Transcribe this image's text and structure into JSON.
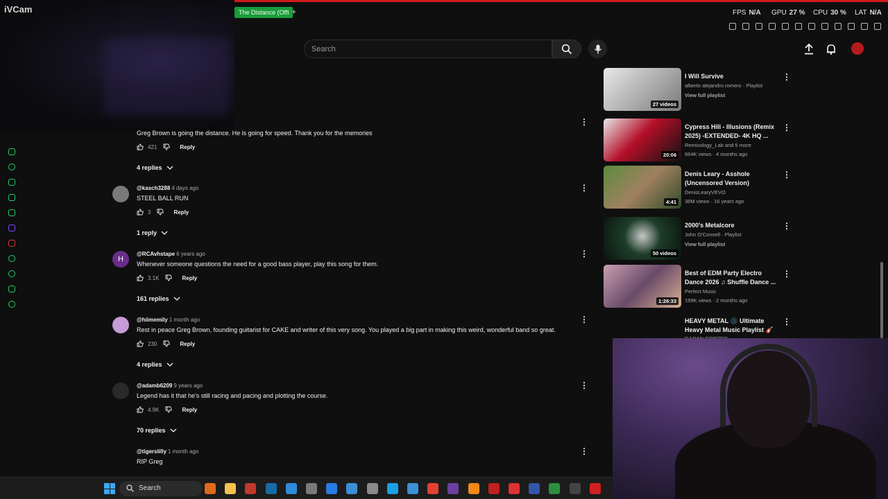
{
  "overlay": {
    "app_name": "iVCam",
    "tab_label": "The Distance (Offi",
    "new_tab": "+",
    "perf": {
      "fps_label": "FPS",
      "fps_value": "N/A",
      "gpu_label": "GPU",
      "gpu_value": "27 %",
      "cpu_label": "CPU",
      "cpu_value": "30 %",
      "lat_label": "LAT",
      "lat_value": "N/A"
    }
  },
  "header": {
    "search_placeholder": "Search",
    "icons": [
      "search-icon",
      "mic-icon",
      "upload-icon",
      "bell-icon",
      "avatar"
    ]
  },
  "comments": [
    {
      "author": "",
      "time": "",
      "text": "Greg Brown is going the distance. He is going for speed. Thank you for the memories",
      "likes": "421",
      "reply_label": "Reply",
      "replies": "4 replies"
    },
    {
      "author": "@kasch3288",
      "time": "4 days ago",
      "text": "STEEL BALL RUN",
      "likes": "3",
      "reply_label": "Reply",
      "replies": "1 reply"
    },
    {
      "author": "@RCAvhstape",
      "time": "6 years ago",
      "avatar_letter": "H",
      "text": "Whenever someone questions the need for a good bass player, play this song for them.",
      "likes": "3.1K",
      "reply_label": "Reply",
      "replies": "161 replies"
    },
    {
      "author": "@hiimemily",
      "time": "1 month ago",
      "text": "Rest in peace Greg Brown, founding guitarist for CAKE and writer of this very song. You played a big part in making this weird, wonderful band so great.",
      "likes": "230",
      "reply_label": "Reply",
      "replies": "4 replies"
    },
    {
      "author": "@adamb6209",
      "time": "9 years ago",
      "text": "Legend has it that he's still racing and pacing and plotting the course.",
      "likes": "4.9K",
      "reply_label": "Reply",
      "replies": "70 replies"
    },
    {
      "author": "@tigerslilly",
      "time": "1 month ago",
      "text": "RIP Greg",
      "likes": "",
      "reply_label": "Reply",
      "replies": ""
    }
  ],
  "playlist": [
    {
      "title": "I Will Survive",
      "meta1": "alberto alejandro romero · Playlist",
      "meta2": "View full playlist",
      "badge": "27 videos",
      "thumb_color": "#d9d9d9"
    },
    {
      "title": "Cypress Hill - Illusions (Remix 2025) -EXTENDED- 4K HQ ...",
      "meta1": "Remixology_Lab and 5 more",
      "meta2": "664K views · 4 months ago",
      "badge": "20:06",
      "thumb_color": "#b5102a"
    },
    {
      "title": "Denis Leary - Asshole (Uncensored Version)",
      "meta1": "DenisLearyVEVO",
      "meta2": "38M views · 16 years ago",
      "badge": "4:41",
      "thumb_color": "#4f7a3a"
    },
    {
      "title": "2000's Metalcore",
      "meta1": "John O'Connell · Playlist",
      "meta2": "View full playlist",
      "badge": "50 videos",
      "thumb_color": "#1e3d2a"
    },
    {
      "title": "Best of EDM Party Electro Dance 2026 ♫ Shuffle Dance ...",
      "meta1": "Perfect Music",
      "meta2": "199K views · 2 months ago",
      "badge": "1:26:33",
      "thumb_color": "#8a6a8a"
    },
    {
      "title": "HEAVY METAL 🌑 Ultimate Heavy Metal Music Playlist 🎸 ...",
      "meta1": "DJ DAN GRIFFER",
      "meta2": "",
      "badge": "",
      "thumb_color": "#0f0f0f"
    }
  ],
  "taskbar": {
    "search_label": "Search",
    "apps": [
      {
        "name": "lava-icon",
        "color": "#e06a1b"
      },
      {
        "name": "file-explorer-icon",
        "color": "#f2c14e"
      },
      {
        "name": "app-icon-1",
        "color": "#c0392b"
      },
      {
        "name": "steam-icon",
        "color": "#1b6aa5"
      },
      {
        "name": "app-icon-2",
        "color": "#2e8bd8"
      },
      {
        "name": "app-icon-3",
        "color": "#7a7a7a"
      },
      {
        "name": "app-icon-4",
        "color": "#2a7be4"
      },
      {
        "name": "app-icon-5",
        "color": "#3b8fd6"
      },
      {
        "name": "app-icon-6",
        "color": "#8a8a8a"
      },
      {
        "name": "app-icon-7",
        "color": "#1aa0e8"
      },
      {
        "name": "app-icon-8",
        "color": "#3d8fd6"
      },
      {
        "name": "chrome-icon",
        "color": "#e34133"
      },
      {
        "name": "app-icon-9",
        "color": "#6b3fa0"
      },
      {
        "name": "vlc-icon",
        "color": "#f08a1a"
      },
      {
        "name": "app-icon-10",
        "color": "#c02020"
      },
      {
        "name": "app-icon-11",
        "color": "#d33"
      },
      {
        "name": "app-icon-12",
        "color": "#3355aa"
      },
      {
        "name": "app-icon-13",
        "color": "#2c8f3f"
      },
      {
        "name": "app-icon-14",
        "color": "#444"
      },
      {
        "name": "acrobat-icon",
        "color": "#d02020"
      }
    ]
  }
}
